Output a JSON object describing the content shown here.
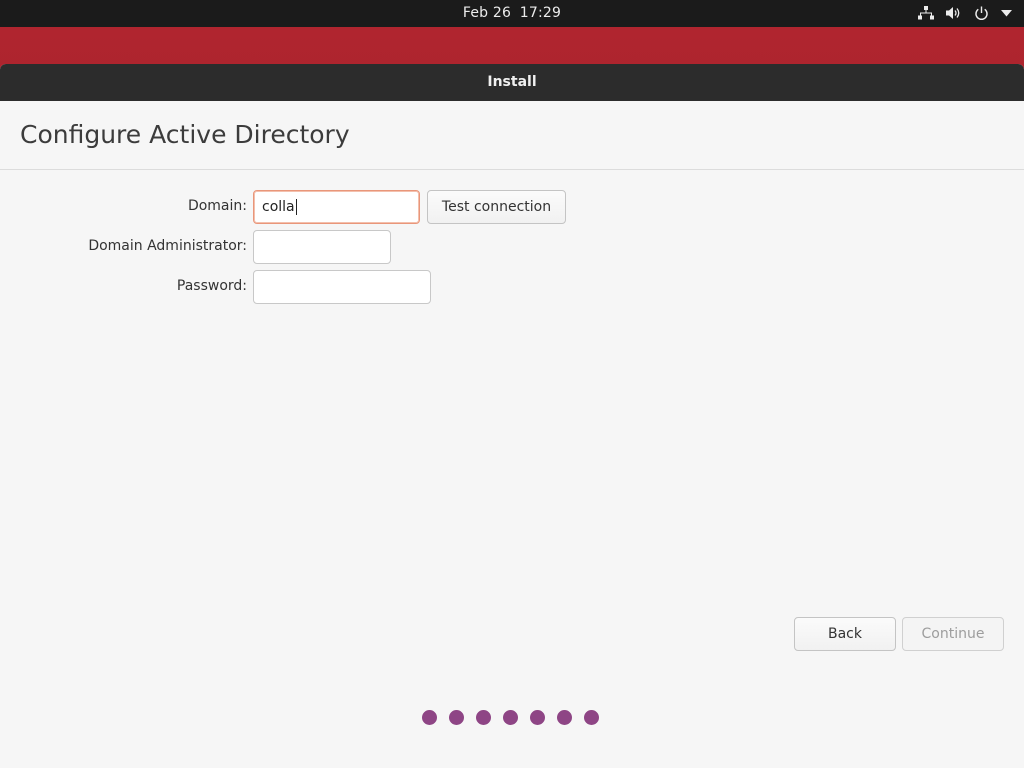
{
  "topbar": {
    "date": "Feb 26",
    "time": "17:29",
    "icons": [
      "network-icon",
      "volume-icon",
      "power-icon",
      "menu-arrow-icon"
    ]
  },
  "window": {
    "title": "Install"
  },
  "page": {
    "title": "Configure Active Directory"
  },
  "form": {
    "domain_label": "Domain:",
    "domain_value": "colla",
    "test_connection_label": "Test connection",
    "admin_label": "Domain Administrator:",
    "admin_value": "",
    "password_label": "Password:",
    "password_value": ""
  },
  "footer": {
    "back_label": "Back",
    "continue_label": "Continue"
  },
  "progress": {
    "dot_count": 7,
    "color": "#8e4585"
  },
  "colors": {
    "wallpaper": "#a5232c",
    "topbar": "#1b1b1b",
    "titlebar": "#2c2c2c",
    "focus_border": "#e9967a"
  }
}
